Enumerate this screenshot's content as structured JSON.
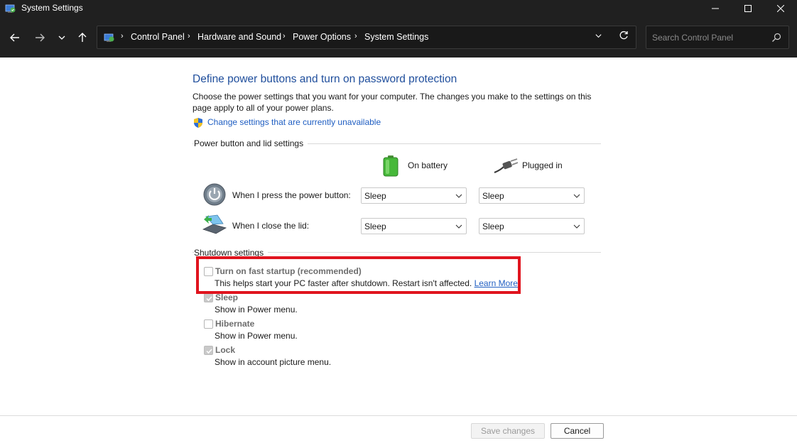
{
  "window": {
    "title": "System Settings",
    "minimize_glyph": "—",
    "maximize_glyph": "☐",
    "close_glyph": "✕"
  },
  "nav": {
    "back_icon": "arrow-left-icon",
    "forward_icon": "arrow-right-icon",
    "recent_icon": "chevron-down-icon",
    "up_icon": "arrow-up-icon"
  },
  "address": {
    "breadcrumbs": [
      "Control Panel",
      "Hardware and Sound",
      "Power Options",
      "System Settings"
    ],
    "separator": "›"
  },
  "search": {
    "placeholder": "Search Control Panel"
  },
  "main": {
    "title": "Define power buttons and turn on password protection",
    "description": "Choose the power settings that you want for your computer. The changes you make to the settings on this page apply to all of your power plans.",
    "change_link": "Change settings that are currently unavailable"
  },
  "power_group": {
    "label": "Power button and lid settings",
    "col_battery": "On battery",
    "col_plugged": "Plugged in",
    "rows": [
      {
        "label": "When I press the power button:",
        "battery": "Sleep",
        "plugged": "Sleep"
      },
      {
        "label": "When I close the lid:",
        "battery": "Sleep",
        "plugged": "Sleep"
      }
    ]
  },
  "shutdown_group": {
    "label": "Shutdown settings",
    "options": [
      {
        "title": "Turn on fast startup (recommended)",
        "desc": "This helps start your PC faster after shutdown. Restart isn't affected.",
        "link": "Learn More",
        "checked": false
      },
      {
        "title": "Sleep",
        "desc": "Show in Power menu.",
        "checked": true
      },
      {
        "title": "Hibernate",
        "desc": "Show in Power menu.",
        "checked": false
      },
      {
        "title": "Lock",
        "desc": "Show in account picture menu.",
        "checked": true
      }
    ]
  },
  "footer": {
    "save_label": "Save changes",
    "cancel_label": "Cancel"
  },
  "colors": {
    "title_blue": "#1f4e9c",
    "link_blue": "#1f5ec2",
    "highlight_red": "#e0141e",
    "chrome_dark": "#202020"
  }
}
